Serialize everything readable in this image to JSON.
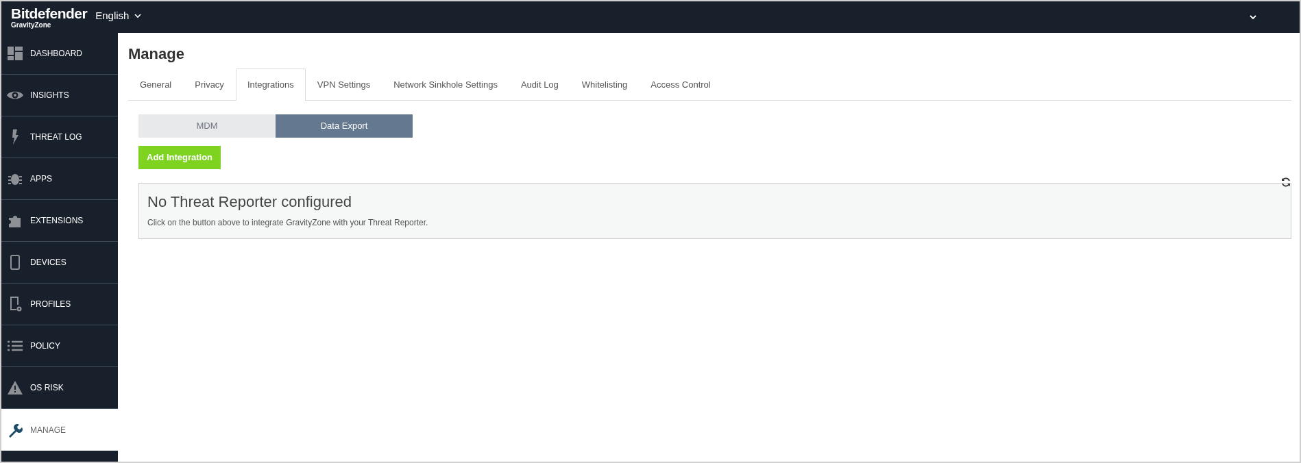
{
  "header": {
    "brand": "Bitdefender",
    "product": "GravityZone",
    "language": "English"
  },
  "sidebar": {
    "items": [
      {
        "label": "DASHBOARD",
        "selected": false
      },
      {
        "label": "INSIGHTS",
        "selected": false
      },
      {
        "label": "THREAT LOG",
        "selected": false
      },
      {
        "label": "APPS",
        "selected": false
      },
      {
        "label": "EXTENSIONS",
        "selected": false
      },
      {
        "label": "DEVICES",
        "selected": false
      },
      {
        "label": "PROFILES",
        "selected": false
      },
      {
        "label": "POLICY",
        "selected": false
      },
      {
        "label": "OS RISK",
        "selected": false
      },
      {
        "label": "MANAGE",
        "selected": true
      }
    ]
  },
  "page": {
    "title": "Manage",
    "tabs": [
      {
        "label": "General",
        "selected": false
      },
      {
        "label": "Privacy",
        "selected": false
      },
      {
        "label": "Integrations",
        "selected": true
      },
      {
        "label": "VPN Settings",
        "selected": false
      },
      {
        "label": "Network Sinkhole Settings",
        "selected": false
      },
      {
        "label": "Audit Log",
        "selected": false
      },
      {
        "label": "Whitelisting",
        "selected": false
      },
      {
        "label": "Access Control",
        "selected": false
      }
    ],
    "segments": [
      {
        "label": "MDM",
        "selected": false
      },
      {
        "label": "Data Export",
        "selected": true
      }
    ],
    "add_button": "Add Integration",
    "empty_state": {
      "title": "No Threat Reporter configured",
      "text": "Click on the button above to integrate GravityZone with your Threat Reporter."
    }
  }
}
